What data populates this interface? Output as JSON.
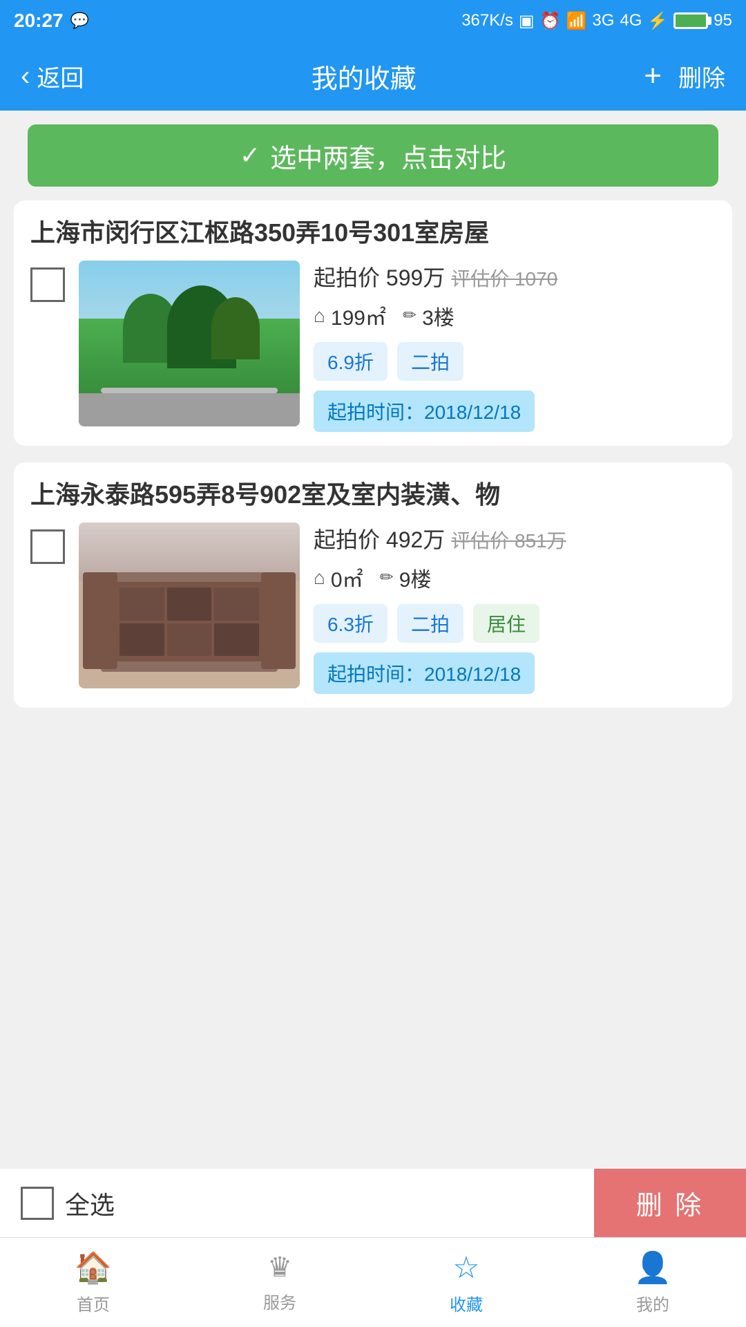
{
  "statusBar": {
    "time": "20:27",
    "network": "367K/s",
    "battery": "95"
  },
  "navBar": {
    "backLabel": "返回",
    "title": "我的收藏",
    "addLabel": "+",
    "deleteLabel": "删除"
  },
  "compareBanner": {
    "icon": "✓",
    "text": "选中两套，点击对比"
  },
  "properties": [
    {
      "id": "prop1",
      "title": "上海市闵行区江枢路350弄10号301室房屋",
      "startingPrice": "起拍价 599万",
      "estimatedPrice": "评估价 1070",
      "area": "199㎡",
      "floor": "3楼",
      "discount": "6.9折",
      "auctionRound": "二拍",
      "residentialTag": "",
      "auctionDate": "起拍时间：2018/12/18",
      "imageType": "outdoor"
    },
    {
      "id": "prop2",
      "title": "上海永泰路595弄8号902室及室内装潢、物",
      "startingPrice": "起拍价 492万",
      "estimatedPrice": "评估价 851万",
      "area": "0㎡",
      "floor": "9楼",
      "discount": "6.3折",
      "auctionRound": "二拍",
      "residentialTag": "居住",
      "auctionDate": "起拍时间：2018/12/18",
      "imageType": "indoor"
    }
  ],
  "bottomBar": {
    "selectAllLabel": "全选",
    "deleteLabel": "删 除"
  },
  "bottomNav": {
    "items": [
      {
        "icon": "🏠",
        "label": "首页",
        "active": false
      },
      {
        "icon": "♛",
        "label": "服务",
        "active": false
      },
      {
        "icon": "☆",
        "label": "收藏",
        "active": true
      },
      {
        "icon": "👤",
        "label": "我的",
        "active": false
      }
    ]
  }
}
